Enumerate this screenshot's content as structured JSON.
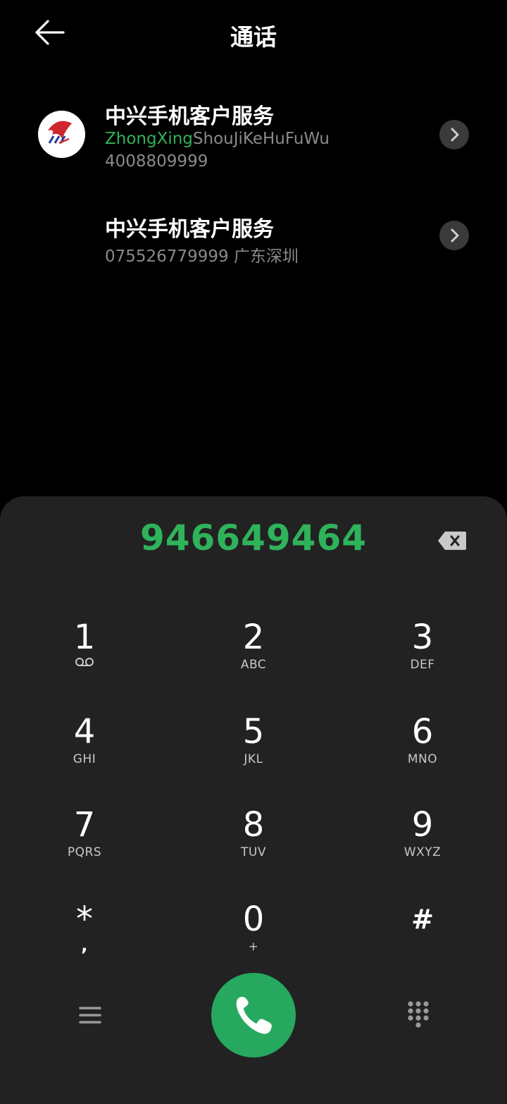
{
  "header": {
    "title": "通话",
    "back_icon": "arrow-left-icon"
  },
  "results": [
    {
      "name": "中兴手机客户服务",
      "pinyin_match": "ZhongXing",
      "pinyin_rest": "ShouJiKeHuFuWu",
      "number": "4008809999",
      "has_avatar": true
    },
    {
      "name": "中兴手机客户服务",
      "number": "075526779999 广东深圳",
      "has_avatar": false
    }
  ],
  "dialpad": {
    "dialed_number": "946649464",
    "keys": [
      {
        "digit": "1",
        "letters": "",
        "icon": "voicemail-icon"
      },
      {
        "digit": "2",
        "letters": "ABC"
      },
      {
        "digit": "3",
        "letters": "DEF"
      },
      {
        "digit": "4",
        "letters": "GHI"
      },
      {
        "digit": "5",
        "letters": "JKL"
      },
      {
        "digit": "6",
        "letters": "MNO"
      },
      {
        "digit": "7",
        "letters": "PQRS"
      },
      {
        "digit": "8",
        "letters": "TUV"
      },
      {
        "digit": "9",
        "letters": "WXYZ"
      },
      {
        "digit": "*",
        "letters": ","
      },
      {
        "digit": "0",
        "letters": "+"
      },
      {
        "digit": "#",
        "letters": ""
      }
    ]
  },
  "colors": {
    "accent_green": "#2fb35a",
    "call_button": "#26a95e",
    "dialpad_bg": "#222223",
    "background": "#000000"
  }
}
